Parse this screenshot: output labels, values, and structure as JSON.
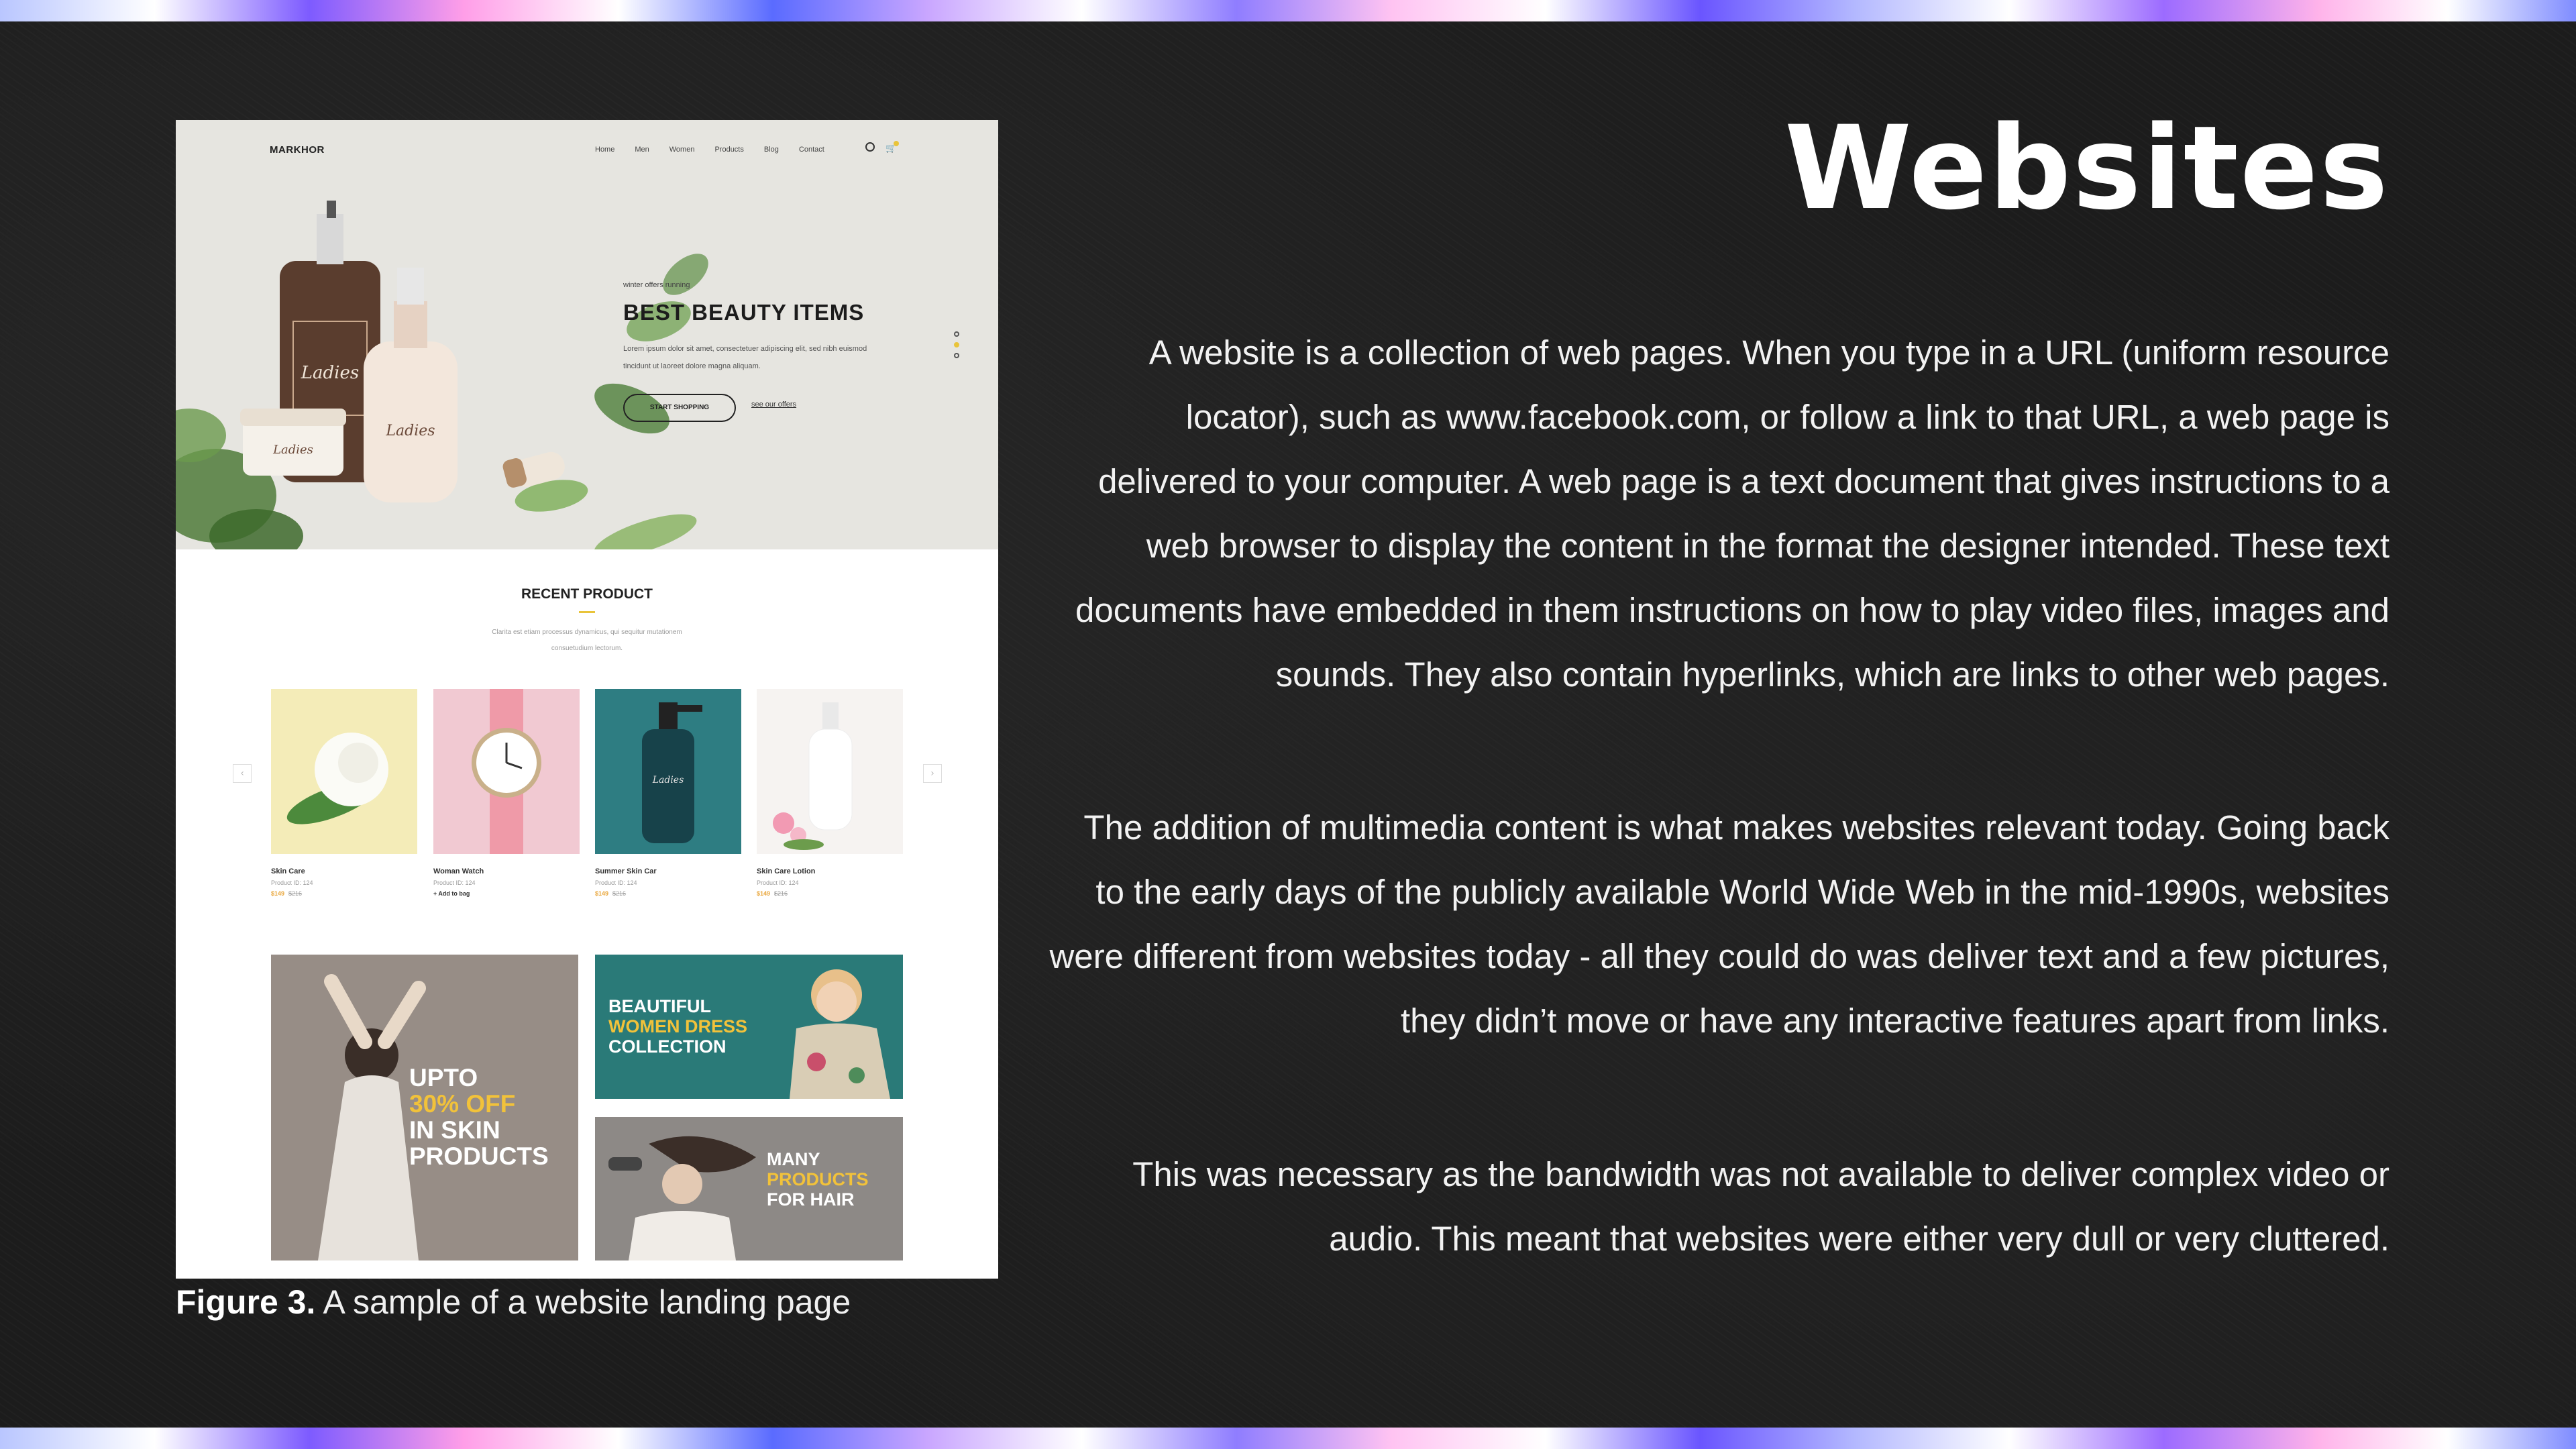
{
  "slide": {
    "heading": "Websites",
    "paragraphs": [
      "A website is a collection of web pages. When you type in a URL (uniform resource locator), such as www.facebook.com, or follow a link to that URL, a web page is delivered to your computer. A web page is a text document that gives instructions to a web browser to display the content in the format the designer intended. These text documents have embedded in them instructions on how to play video files, images and sounds. They also contain hyperlinks, which are links to other web pages.",
      "The addition of multimedia content is what makes websites relevant today. Going back to the early days of the publicly available World Wide Web in the mid-1990s, websites were different from websites today - all they could do was deliver text and a few pictures, they didn’t move or have any interactive features apart from links.",
      "This was necessary as the bandwidth was not available to deliver complex video or audio. This meant that websites were either very dull or very cluttered."
    ],
    "caption": {
      "label": "Figure 3.",
      "text": " A sample of a website landing page"
    }
  },
  "figure": {
    "logo": "MARKHOR",
    "nav": [
      "Home",
      "Men",
      "Women",
      "Products",
      "Blog",
      "Contact"
    ],
    "hero": {
      "pretitle": "winter offers running",
      "title": "BEST BEAUTY ITEMS",
      "body": "Lorem ipsum dolor sit amet, consectetuer adipiscing elit, sed nibh euismod tincidunt ut laoreet dolore magna aliquam.",
      "button": "START SHOPPING",
      "link": "see our offers",
      "bottle_label": "Ladies"
    },
    "recent": {
      "title": "RECENT PRODUCT",
      "subtitle": "Clarita est etiam processus dynamicus, qui sequitur mutationem consuetudium lectorum."
    },
    "products": [
      {
        "name": "Skin Care",
        "id": "Product ID: 124",
        "price": "$149",
        "old": "$216",
        "bg": "#f4ecb8"
      },
      {
        "name": "Woman Watch",
        "id": "Product ID: 124",
        "price": "+ Add to bag",
        "old": "",
        "bg": "#f1c9d2"
      },
      {
        "name": "Summer Skin Car",
        "id": "Product ID: 124",
        "price": "$149",
        "old": "$216",
        "bg": "#2e7d82"
      },
      {
        "name": "Skin Care Lotion",
        "id": "Product ID: 124",
        "price": "$149",
        "old": "$216",
        "bg": "#f6f3f1"
      }
    ],
    "promos": [
      {
        "lines": [
          "UPTO"
        ],
        "highlight": "30% OFF",
        "rest": [
          "IN SKIN",
          "PRODUCTS"
        ]
      },
      {
        "lines": [
          "BEAUTIFUL"
        ],
        "highlight": "WOMEN DRESS",
        "rest": [
          "COLLECTION"
        ]
      },
      {
        "lines": [
          "MANY"
        ],
        "highlight": "PRODUCTS",
        "rest": [
          "FOR HAIR"
        ]
      }
    ]
  },
  "colors": {
    "background": "#1c1c1c",
    "text": "#f2f2f2",
    "accent_yellow": "#e9c43a",
    "teal": "#2e7d82",
    "stripe_purple": "#7d5bff"
  }
}
